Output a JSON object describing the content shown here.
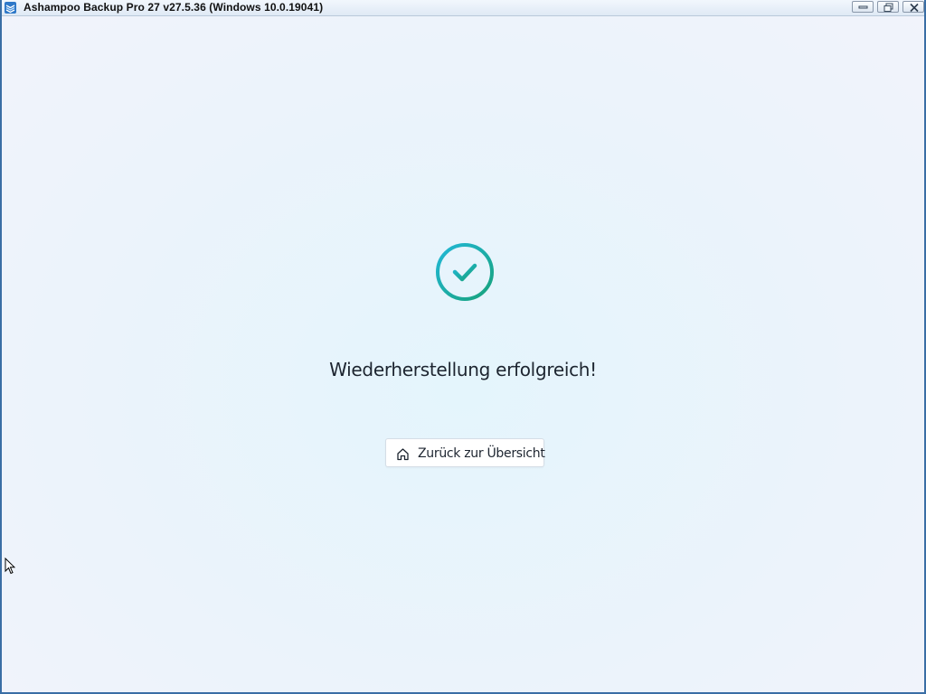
{
  "window": {
    "title": "Ashampoo Backup Pro 27 v27.5.36 (Windows 10.0.19041)",
    "icon": "app-icon",
    "controls": [
      "minimize-icon",
      "maximize-icon",
      "close-icon"
    ]
  },
  "main": {
    "status_icon": "check-circle-icon",
    "headline": "Wiederherstellung erfolgreich!",
    "overview_button": {
      "label": "Zurück zur Übersicht",
      "icon": "home-icon"
    }
  },
  "colors": {
    "accent_start": "#1fb5d6",
    "accent_end": "#1aa37a",
    "text": "#1d2530",
    "window_border": "#3a6ea5"
  }
}
